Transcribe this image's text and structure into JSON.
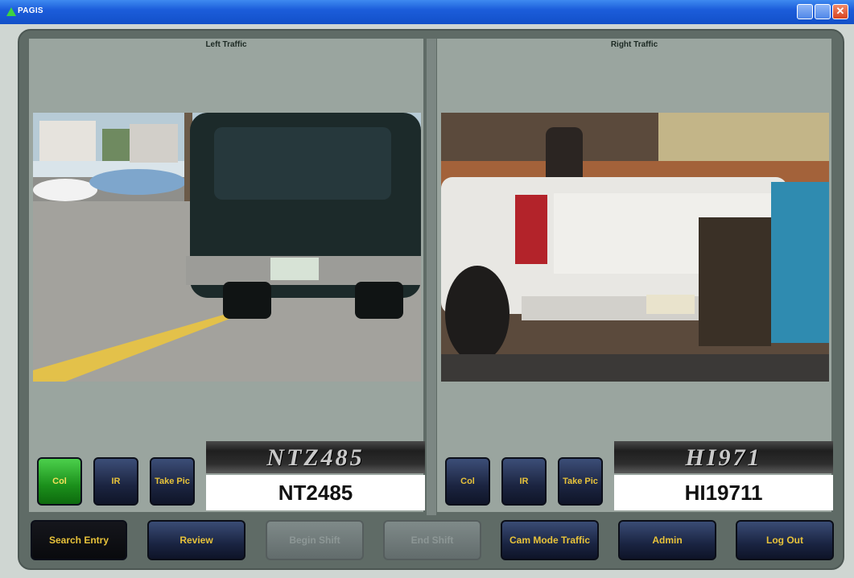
{
  "window": {
    "title": "PAGIS",
    "close_label": "✕"
  },
  "left_pane": {
    "title": "Left Traffic",
    "buttons": {
      "col": "Col",
      "ir": "IR",
      "take_pic": "Take Pic"
    },
    "plate_image_text": "NTZ485",
    "plate_text": "NT2485"
  },
  "right_pane": {
    "title": "Right Traffic",
    "buttons": {
      "col": "Col",
      "ir": "IR",
      "take_pic": "Take Pic"
    },
    "plate_image_text": "HI971",
    "plate_text": "HI19711"
  },
  "bottom_bar": {
    "search_entry": "Search Entry",
    "review": "Review",
    "begin_shift": "Begin Shift",
    "end_shift": "End Shift",
    "cam_mode": "Cam Mode Traffic",
    "admin": "Admin",
    "log_out": "Log Out"
  },
  "colors": {
    "titlebar": "#1c5ddb",
    "panel_bg": "#9aa59f",
    "button_text": "#e7c23a",
    "active_button": "#1b8f1b"
  }
}
